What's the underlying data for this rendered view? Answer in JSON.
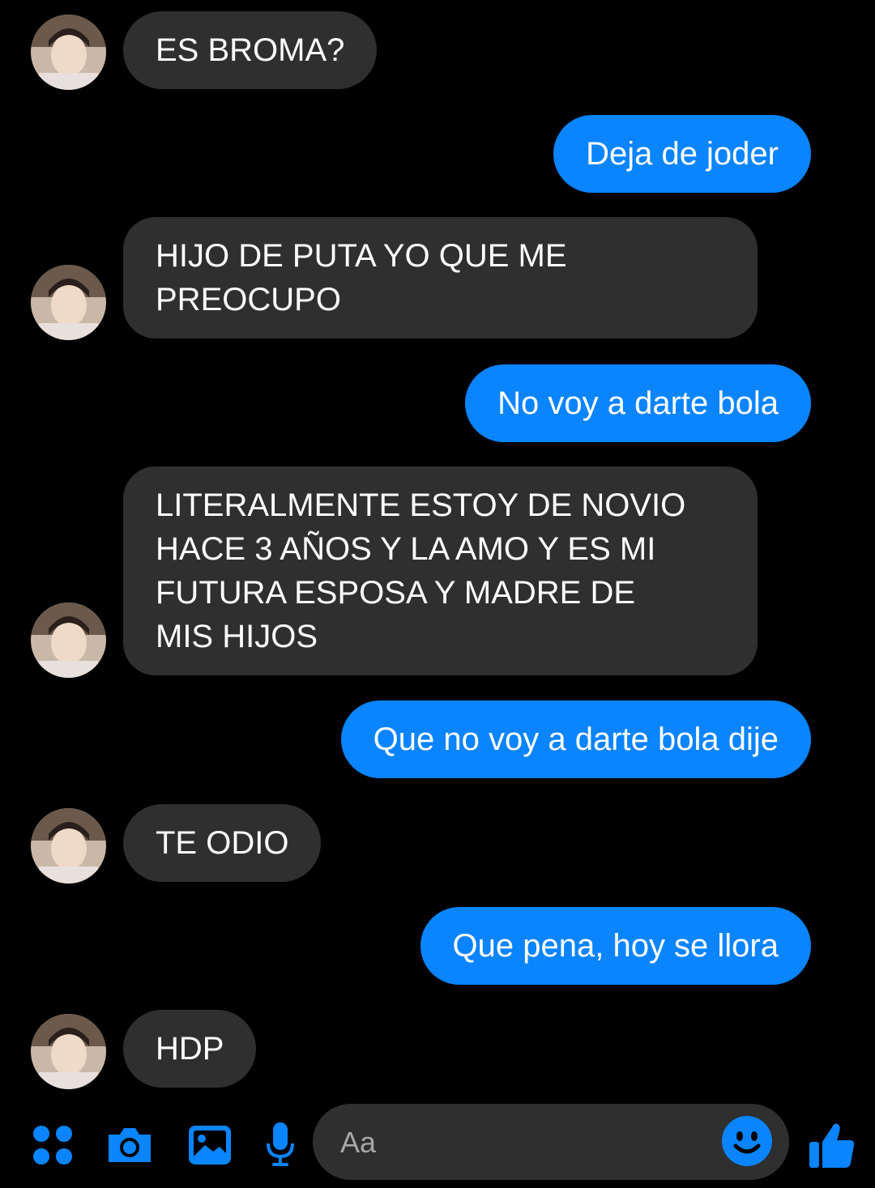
{
  "colors": {
    "background": "#000000",
    "incoming_bubble": "#2f2f2f",
    "outgoing_bubble": "#0a84ff",
    "accent": "#0a84ff"
  },
  "messages": [
    {
      "sender": "them",
      "text": "ES BROMA?"
    },
    {
      "sender": "me",
      "text": "Deja de joder"
    },
    {
      "sender": "them",
      "text": "HIJO DE PUTA YO QUE ME\nPREOCUPO"
    },
    {
      "sender": "me",
      "text": "No voy a darte bola"
    },
    {
      "sender": "them",
      "text": "LITERALMENTE ESTOY DE NOVIO\nHACE 3 AÑOS Y LA AMO Y ES MI\nFUTURA ESPOSA Y MADRE DE\nMIS HIJOS"
    },
    {
      "sender": "me",
      "text": "Que no voy a darte bola dije"
    },
    {
      "sender": "them",
      "text": "TE ODIO"
    },
    {
      "sender": "me",
      "text": "Que pena, hoy se llora"
    },
    {
      "sender": "them",
      "text": "HDP"
    }
  ],
  "composer": {
    "placeholder": "Aa",
    "icons": [
      "menu-dots-icon",
      "camera-icon",
      "gallery-icon",
      "microphone-icon",
      "emoji-icon",
      "thumbs-up-icon"
    ]
  }
}
